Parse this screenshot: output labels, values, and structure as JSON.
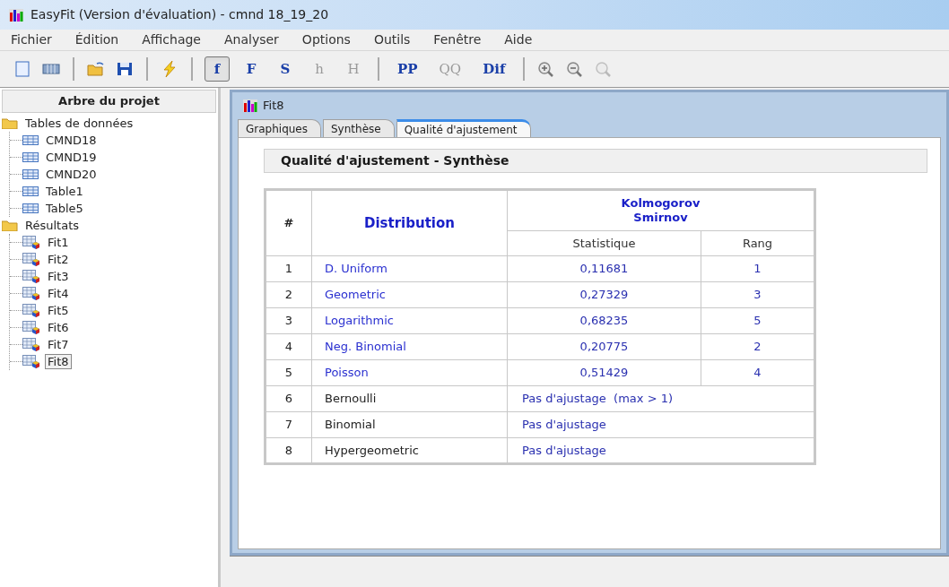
{
  "window": {
    "title": "EasyFit (Version d'évaluation) - cmnd 18_19_20"
  },
  "menu": [
    "Fichier",
    "Édition",
    "Affichage",
    "Analyser",
    "Options",
    "Outils",
    "Fenêtre",
    "Aide"
  ],
  "toolbar": [
    {
      "kind": "icon",
      "disabled": false
    },
    {
      "kind": "icon",
      "disabled": false
    },
    {
      "kind": "separator"
    },
    {
      "kind": "icon",
      "disabled": false
    },
    {
      "kind": "icon",
      "disabled": false
    },
    {
      "kind": "separator"
    },
    {
      "kind": "icon",
      "disabled": false
    },
    {
      "kind": "separator"
    },
    {
      "kind": "text",
      "label": "f",
      "selected": true,
      "disabled": false
    },
    {
      "kind": "text",
      "label": "F",
      "selected": false,
      "disabled": false
    },
    {
      "kind": "text",
      "label": "S",
      "selected": false,
      "disabled": false
    },
    {
      "kind": "text",
      "label": "h",
      "selected": false,
      "disabled": true
    },
    {
      "kind": "text",
      "label": "H",
      "selected": false,
      "disabled": true
    },
    {
      "kind": "separator"
    },
    {
      "kind": "text",
      "label": "PP",
      "selected": false,
      "disabled": false
    },
    {
      "kind": "text",
      "label": "QQ",
      "selected": false,
      "disabled": true
    },
    {
      "kind": "text",
      "label": "Dif",
      "selected": false,
      "disabled": false
    },
    {
      "kind": "separator"
    },
    {
      "kind": "icon",
      "disabled": false
    },
    {
      "kind": "icon",
      "disabled": false
    },
    {
      "kind": "icon",
      "disabled": true
    }
  ],
  "project_tree": {
    "title": "Arbre du projet",
    "items": [
      {
        "label": "Tables de données",
        "kind": "folder",
        "selected": false,
        "children": [
          {
            "label": "CMND18",
            "kind": "table",
            "selected": false
          },
          {
            "label": "CMND19",
            "kind": "table",
            "selected": false
          },
          {
            "label": "CMND20",
            "kind": "table",
            "selected": false
          },
          {
            "label": "Table1",
            "kind": "table",
            "selected": false
          },
          {
            "label": "Table5",
            "kind": "table",
            "selected": false
          }
        ]
      },
      {
        "label": "Résultats",
        "kind": "folder",
        "selected": false,
        "children": [
          {
            "label": "Fit1",
            "kind": "fit",
            "selected": false
          },
          {
            "label": "Fit2",
            "kind": "fit",
            "selected": false
          },
          {
            "label": "Fit3",
            "kind": "fit",
            "selected": false
          },
          {
            "label": "Fit4",
            "kind": "fit",
            "selected": false
          },
          {
            "label": "Fit5",
            "kind": "fit",
            "selected": false
          },
          {
            "label": "Fit6",
            "kind": "fit",
            "selected": false
          },
          {
            "label": "Fit7",
            "kind": "fit",
            "selected": false
          },
          {
            "label": "Fit8",
            "kind": "fit",
            "selected": true
          }
        ]
      }
    ]
  },
  "document": {
    "title": "Fit8",
    "tabs": [
      {
        "label": "Graphiques",
        "selected": false
      },
      {
        "label": "Synthèse",
        "selected": false
      },
      {
        "label": "Qualité d'ajustement",
        "selected": true
      }
    ],
    "heading": "Qualité d'ajustement - Synthèse",
    "table": {
      "columns": {
        "number": "#",
        "distribution": "Distribution",
        "test": "Kolmogorov Smirnov",
        "statistic": "Statistique",
        "rank": "Rang"
      },
      "rows": [
        {
          "kind": "fit",
          "number": "1",
          "distribution": "D. Uniform",
          "statistic": "0,11681",
          "rank": "1"
        },
        {
          "kind": "fit",
          "number": "2",
          "distribution": "Geometric",
          "statistic": "0,27329",
          "rank": "3"
        },
        {
          "kind": "fit",
          "number": "3",
          "distribution": "Logarithmic",
          "statistic": "0,68235",
          "rank": "5"
        },
        {
          "kind": "fit",
          "number": "4",
          "distribution": "Neg. Binomial",
          "statistic": "0,20775",
          "rank": "2"
        },
        {
          "kind": "fit",
          "number": "5",
          "distribution": "Poisson",
          "statistic": "0,51429",
          "rank": "4"
        },
        {
          "kind": "no_fit",
          "number": "6",
          "distribution": "Bernoulli",
          "message": "Pas d'ajustage  (max > 1)"
        },
        {
          "kind": "no_fit",
          "number": "7",
          "distribution": "Binomial",
          "message": "Pas d'ajustage"
        },
        {
          "kind": "no_fit",
          "number": "8",
          "distribution": "Hypergeometric",
          "message": "Pas d'ajustage"
        }
      ]
    }
  }
}
